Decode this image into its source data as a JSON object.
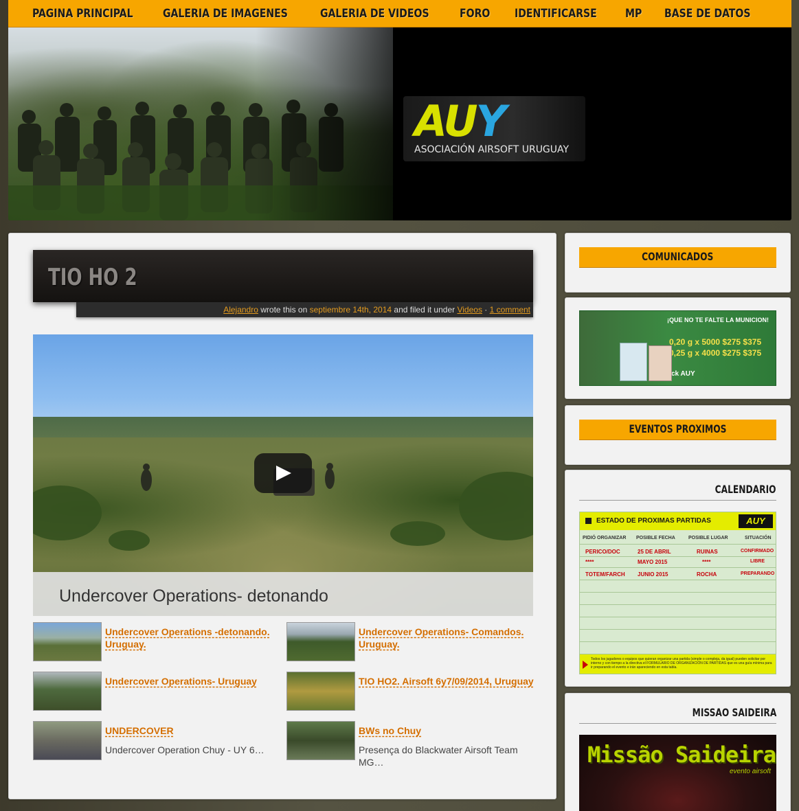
{
  "nav": {
    "items": [
      "PAGINA PRINCIPAL",
      "GALERIA DE IMAGENES",
      "GALERIA DE VIDEOS",
      "FORO",
      "IDENTIFICARSE",
      "MP",
      "BASE DE DATOS"
    ]
  },
  "banner": {
    "logo_main_a": "AU",
    "logo_main_y": "Y",
    "logo_sub": "ASOCIACIÓN AIRSOFT URUGUAY"
  },
  "post": {
    "title": "TIO HO 2",
    "author": "Alejandro",
    "wrote_text": "wrote this on",
    "date": "septiembre 14th, 2014",
    "filed_text": "and filed it under",
    "category": "Videos",
    "separator": "·",
    "comments": "1 comment"
  },
  "video": {
    "caption": "Undercover Operations- detonando"
  },
  "related": [
    {
      "title": "Undercover Operations -detonando. Uruguay.",
      "desc": ""
    },
    {
      "title": "Undercover Operations- Comandos. Uruguay.",
      "desc": ""
    },
    {
      "title": "Undercover Operations- Uruguay",
      "desc": ""
    },
    {
      "title": "TIO HO2. Airsoft 6y7/09/2014, Uruguay",
      "desc": ""
    },
    {
      "title": "UNDERCOVER",
      "desc": "Undercover Operation Chuy - UY 6…"
    },
    {
      "title": "BWs no Chuy",
      "desc": "Presença do Blackwater Airsoft Team MG…"
    }
  ],
  "sidebar": {
    "comunicados": "COMUNICADOS",
    "eventos": "EVENTOS PROXIMOS",
    "calendario": "CALENDARIO",
    "missao": "MISSAO SAIDEIRA"
  },
  "ad": {
    "headline": "¡QUE NO TE FALTE LA MUNICION!",
    "line1": "0,20 g x 5000  $275  $375",
    "line2": "0,25 g x 4000  $275  $375",
    "stock": "stock AUY"
  },
  "calendar": {
    "header": "ESTADO DE PROXIMAS PARTIDAS",
    "badge": "AUY",
    "columns": [
      "PIDIÓ ORGANIZAR",
      "POSIBLE FECHA",
      "POSIBLE LUGAR",
      "SITUACIÓN"
    ],
    "rows": [
      [
        "PERICO/DOC",
        "25 DE ABRIL",
        "RUINAS",
        "CONFIRMADO"
      ],
      [
        "****",
        "MAYO 2015",
        "****",
        "LIBRE"
      ],
      [
        "TOTEM/FARCH",
        "JUNIO 2015",
        "ROCHA",
        "PREPARANDO"
      ]
    ],
    "footer": "Todos los jugadores o equipos que quieran organizar una partida (simple o compleja, da igual) pueden solicitar por interno y con tiempo a la directiva el FORMULARIO DE ORGANIZACIÓN DE PARTIDAS que es una guía mínima para ir preparando el evento e irán apareciendo en esta tabla."
  },
  "missao": {
    "title": "Missão Saideira",
    "sub": "evento airsoft"
  }
}
